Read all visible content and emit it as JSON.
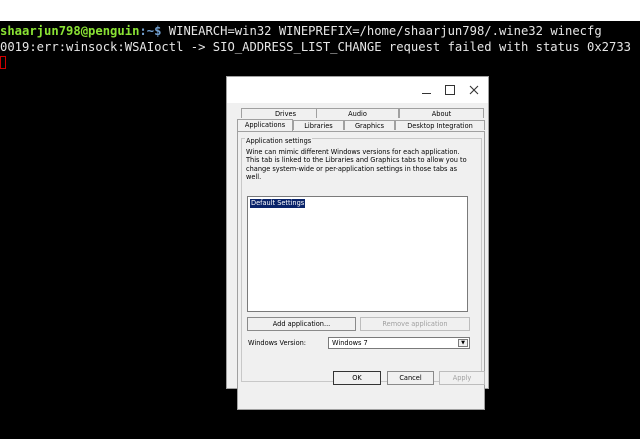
{
  "terminal": {
    "prompt_user": "shaarjun798@penguin",
    "prompt_path": ":~$",
    "command": " WINEARCH=win32 WINEPREFIX=/home/shaarjun798/.wine32 winecfg",
    "error_line": "0019:err:winsock:WSAIoctl -> SIO_ADDRESS_LIST_CHANGE request failed with status 0x2733"
  },
  "dialog": {
    "tabs_row1": [
      "Drives",
      "Audio",
      "About"
    ],
    "tabs_row2": [
      "Applications",
      "Libraries",
      "Graphics",
      "Desktop Integration"
    ],
    "active_tab": "Applications",
    "group_title": "Application settings",
    "description": "Wine can mimic different Windows versions for each application. This tab is linked to the Libraries and Graphics tabs to allow you to change system-wide or per-application settings in those tabs as well.",
    "list_items": [
      "Default Settings"
    ],
    "add_button": "Add application...",
    "remove_button": "Remove application",
    "version_label": "Windows Version:",
    "version_value": "Windows 7",
    "ok_button": "OK",
    "cancel_button": "Cancel",
    "apply_button": "Apply"
  },
  "colors": {
    "terminal_bg": "#000000",
    "prompt_user": "#8ae234",
    "prompt_path": "#729fcf",
    "selection": "#0a246a"
  }
}
